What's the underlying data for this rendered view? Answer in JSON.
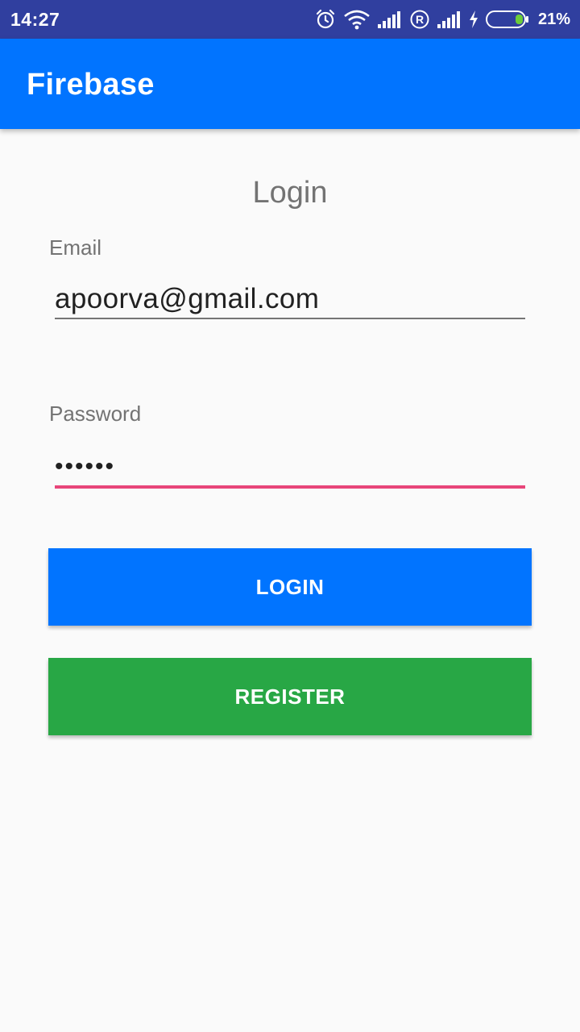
{
  "status_bar": {
    "time": "14:27",
    "battery_percent": "21%",
    "icons": [
      "alarm-icon",
      "wifi-icon",
      "signal-icon",
      "roaming-icon",
      "signal-icon",
      "charging-icon",
      "battery-icon"
    ],
    "color": "#303f9f"
  },
  "app_bar": {
    "title": "Firebase",
    "color": "#0174ff"
  },
  "form": {
    "heading": "Login",
    "email": {
      "label": "Email",
      "value": "apoorva@gmail.com"
    },
    "password": {
      "label": "Password",
      "value": "••••••",
      "focus_color": "#e8457a"
    },
    "login_button": {
      "label": "LOGIN",
      "color": "#0174ff"
    },
    "register_button": {
      "label": "REGISTER",
      "color": "#28a745"
    }
  }
}
